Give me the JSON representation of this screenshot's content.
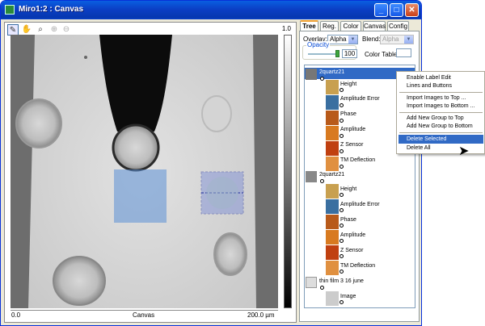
{
  "window": {
    "title": "Miro1:2 : Canvas"
  },
  "titlebar_buttons": {
    "minimize": "_",
    "maximize": "□",
    "close": "✕"
  },
  "canvas": {
    "tools": [
      "pencil-icon",
      "hand-icon",
      "zoom-icon",
      "zoom-in-icon",
      "zoom-out-icon"
    ],
    "colorbar_max": "1.0",
    "axis": {
      "left": "0.0",
      "middle": "Canvas",
      "right": "200.0 µm"
    }
  },
  "tabs": [
    "Tree",
    "Reg.",
    "Color",
    "Canvas",
    "Config"
  ],
  "tree_panel": {
    "overlay_label": "Overlay:",
    "overlay_value": "Alpha",
    "blend_label": "Blend:",
    "blend_value": "Alpha",
    "opacity_label": "Opacity",
    "opacity_value": "100",
    "color_table_label": "Color Table:"
  },
  "tree": {
    "group1": {
      "label": "2quartz21",
      "children": [
        "Height",
        "Amplitude Error",
        "Phase",
        "Amplitude",
        "Z Sensor",
        "TM Deflection"
      ]
    },
    "group2": {
      "label": "2quartz21",
      "children": [
        "Height",
        "Amplitude Error",
        "Phase",
        "Amplitude",
        "Z Sensor",
        "TM Deflection"
      ]
    },
    "group3": {
      "label": "thin film 3 16 june",
      "children": [
        "Image"
      ]
    }
  },
  "context_menu": {
    "items": [
      "Enable Label Edit",
      "Lines and Buttons",
      "Import Images to Top ...",
      "Import Images to Bottom ...",
      "Add New Group to Top",
      "Add New Group to Bottom",
      "Delete Selected",
      "Delete All"
    ],
    "highlighted": "Delete Selected"
  },
  "colors": {
    "accent": "#316ac5",
    "titlebar": "#0b3fc5"
  }
}
